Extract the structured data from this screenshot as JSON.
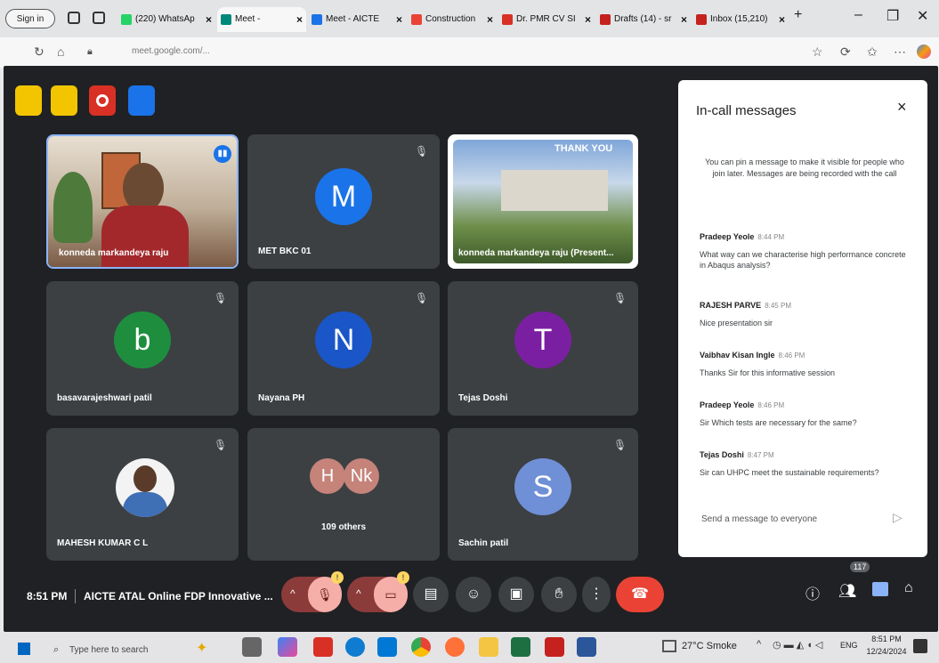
{
  "browser": {
    "signin_label": "Sign in",
    "tabs": [
      {
        "label": "(220) WhatsAp",
        "color": "#25d366"
      },
      {
        "label": "Meet -",
        "color": "#00897b"
      },
      {
        "label": "Meet - AICTE",
        "color": "#1a73e8"
      },
      {
        "label": "Construction",
        "color": "#ea4335"
      },
      {
        "label": "Dr. PMR CV SI",
        "color": "#d93025"
      },
      {
        "label": "Drafts (14) - sr",
        "color": "#c5221f"
      },
      {
        "label": "Inbox (15,210)",
        "color": "#c5221f"
      }
    ],
    "new_tab": "+",
    "url": "meet.google.com/..."
  },
  "meet": {
    "tiles": [
      {
        "name": "konneda markandeya raju",
        "type": "video"
      },
      {
        "name": "MET BKC 01",
        "initial": "M",
        "color": "#1a73e8"
      },
      {
        "name": "konneda markandeya raju (Present...",
        "type": "presentation",
        "slide_text": "THANK YOU"
      },
      {
        "name": "basavarajeshwari patil",
        "initial": "b",
        "color": "#1e8e3e"
      },
      {
        "name": "Nayana PH",
        "initial": "N",
        "color": "#1a56c8"
      },
      {
        "name": "Tejas Doshi",
        "initial": "T",
        "color": "#7b1fa2"
      },
      {
        "name": "MAHESH KUMAR C L",
        "type": "photo"
      },
      {
        "name": "109 others",
        "initials": [
          "H",
          "Nk"
        ],
        "color": "#c5837a"
      },
      {
        "name": "Sachin patil",
        "initial": "S",
        "color": "#6f8fd6"
      }
    ],
    "time": "8:51 PM",
    "meeting_title": "AICTE ATAL Online FDP Innovative ...",
    "people_count": "117"
  },
  "panel": {
    "title": "In-call messages",
    "close": "×",
    "info": "You can pin a message to make it visible for people who join later. Messages are being recorded with the call",
    "messages": [
      {
        "sender": "Pradeep Yeole",
        "time": "8:44 PM",
        "text": "What way can we characterise high performance concrete in Abaqus analysis?"
      },
      {
        "sender": "RAJESH PARVE",
        "time": "8:45 PM",
        "text": "Nice presentation sir"
      },
      {
        "sender": "Vaibhav Kisan Ingle",
        "time": "8:46 PM",
        "text": "Thanks Sir for this informative session"
      },
      {
        "sender": "Pradeep Yeole",
        "time": "8:46 PM",
        "text": "Sir Which tests are necessary for the same?"
      },
      {
        "sender": "Tejas Doshi",
        "time": "8:47 PM",
        "text": "Sir can UHPC meet the sustainable requirements?"
      }
    ],
    "input_placeholder": "Send a message to everyone"
  },
  "taskbar": {
    "search_placeholder": "Type here to search",
    "weather": "27°C Smoke",
    "lang": "ENG",
    "clock_time": "8:51 PM",
    "clock_date": "12/24/2024"
  }
}
